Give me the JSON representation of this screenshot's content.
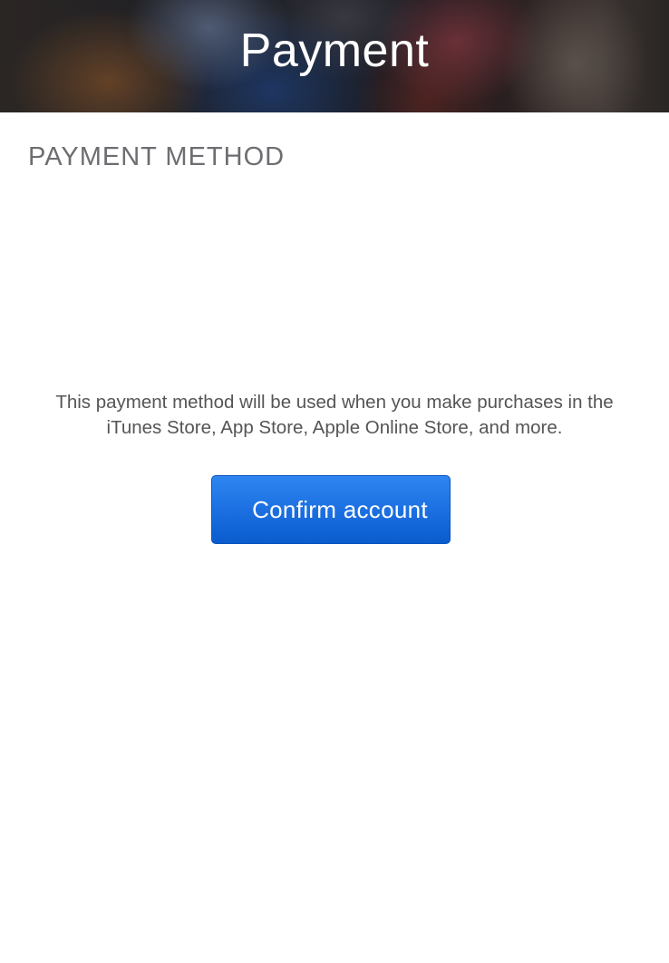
{
  "header": {
    "title": "Payment"
  },
  "section": {
    "title": "PAYMENT METHOD"
  },
  "description": {
    "line1": "This payment method will be used when you make purchases in the",
    "line2": "iTunes Store, App Store, Apple Online Store, and more."
  },
  "actions": {
    "confirm_label": "Confirm account"
  },
  "colors": {
    "accent": "#1c70e2",
    "section_text": "#6d6d72",
    "body_text": "#555555",
    "background": "#ffffff"
  }
}
